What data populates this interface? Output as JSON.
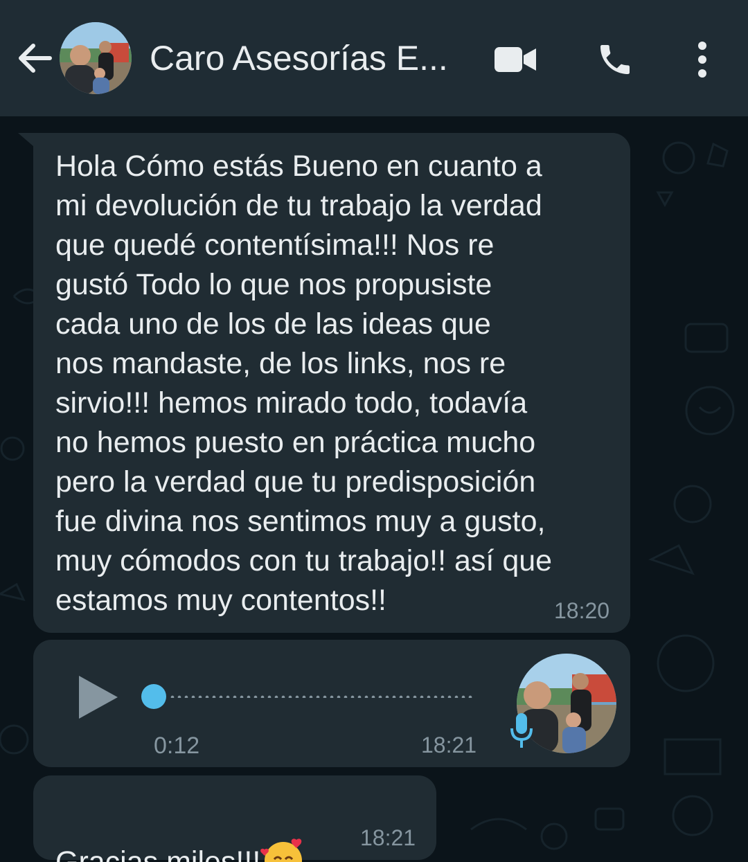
{
  "header": {
    "title": "Caro Asesorías E...",
    "icons": [
      "back-arrow-icon",
      "video-call-icon",
      "phone-icon",
      "more-vert-icon"
    ]
  },
  "messages": [
    {
      "type": "text",
      "text": "Hola Cómo estás Bueno en cuanto a\nmi devolución de tu trabajo la verdad\nque quedé contentísima!!! Nos re\ngustó Todo lo que nos propusiste\ncada uno de los de las ideas que\nnos mandaste, de los links, nos re\nsirvio!!! hemos mirado todo, todavía\nno hemos puesto en práctica mucho\npero la verdad que tu predisposición\nfue divina nos sentimos muy a gusto,\nmuy cómodos con tu trabajo!! así que\nestamos muy contentos!!",
      "time": "18:20"
    },
    {
      "type": "voice",
      "duration": "0:12",
      "time": "18:21",
      "progress": 0
    },
    {
      "type": "text",
      "text": "Gracias miles!!!",
      "emoji": "smiling-face-with-hearts",
      "time": "18:21"
    }
  ],
  "colors": {
    "header_bg": "#1f2c34",
    "chat_bg": "#0b141a",
    "bubble_bg": "#202c33",
    "text": "#e9edef",
    "meta": "#8696a0",
    "accent": "#53bdeb"
  }
}
